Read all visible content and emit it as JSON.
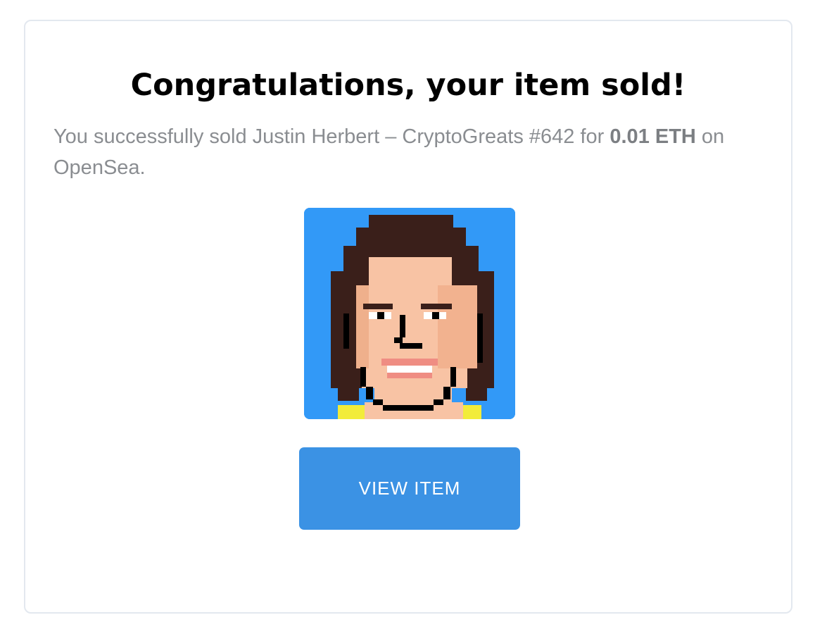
{
  "dialog": {
    "title": "Congratulations, your item sold!",
    "message_prefix": "You successfully sold Justin Herbert – CryptoGreats #642 for ",
    "price": "0.01 ETH",
    "message_suffix": " on OpenSea.",
    "item_image": "pixel-art-portrait",
    "button_label": "VIEW ITEM"
  },
  "colors": {
    "button": "#3b92e4",
    "image_background": "#3299f7",
    "hair": "#3a1f1a",
    "skin": "#f8c3a4",
    "shirt": "#f2ec3a"
  }
}
